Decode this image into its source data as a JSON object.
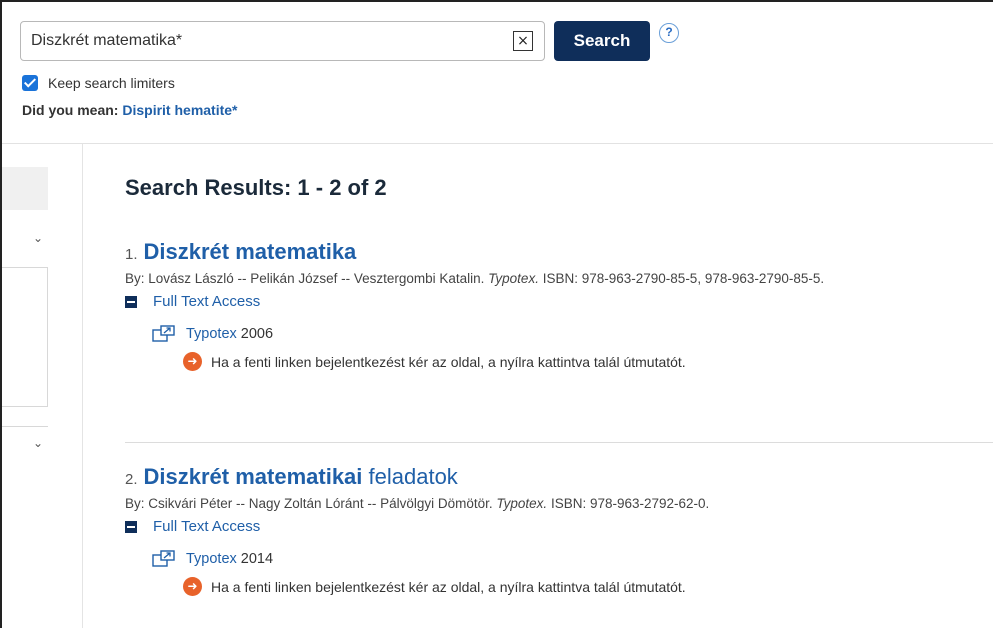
{
  "search": {
    "query": "Diszkrét matematika*",
    "clear_label": "×",
    "button_label": "Search",
    "help_label": "?"
  },
  "limiters": {
    "keep_label": "Keep search limiters",
    "keep_checked": true
  },
  "did_you_mean": {
    "prefix": "Did you mean:",
    "suggestion": "Dispirit hematite*"
  },
  "sidebar": {
    "chevron": "⌄"
  },
  "results": {
    "heading": "Search Results: 1 - 2 of 2",
    "items": [
      {
        "number": "1.",
        "title_highlight": "Diszkrét matematika",
        "title_rest": "",
        "authors": "By: Lovász László -- Pelikán József -- Vesztergombi Katalin.",
        "publisher": "Typotex.",
        "isbn": "ISBN: 978-963-2790-85-5, 978-963-2790-85-5.",
        "full_text_label": "Full Text Access",
        "link_label": "Typotex",
        "link_year": "2006",
        "note": "Ha a fenti linken bejelentkezést kér az oldal, a nyílra kattintva talál útmutatót."
      },
      {
        "number": "2.",
        "title_highlight": "Diszkrét matematikai",
        "title_rest": " feladatok",
        "authors": "By: Csikvári Péter -- Nagy Zoltán Lóránt -- Pálvölgyi Dömötör.",
        "publisher": "Typotex.",
        "isbn": "ISBN: 978-963-2792-62-0.",
        "full_text_label": "Full Text Access",
        "link_label": "Typotex",
        "link_year": "2014",
        "note": "Ha a fenti linken bejelentkezést kér az oldal, a nyílra kattintva talál útmutatót."
      }
    ]
  },
  "colors": {
    "primary": "#0f2e5a",
    "link": "#1f5fa8",
    "checkbox": "#1a73d9",
    "note_arrow": "#e8622a"
  }
}
